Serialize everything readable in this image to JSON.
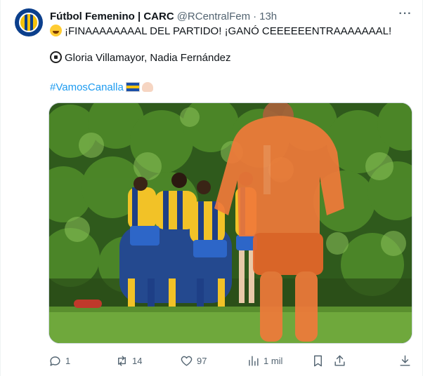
{
  "tweet": {
    "display_name": "Fútbol Femenino | CARC",
    "handle": "@RCentralFem",
    "separator": "·",
    "time": "13h",
    "more_label": "···",
    "line1": "¡FINAAAAAAAAL DEL PARTIDO! ¡GANÓ CEEEEEENTRAAAAAAAL!",
    "line2": "Gloria Villamayor, Nadia Fernández",
    "hashtag": "#VamosCanalla",
    "icons": {
      "line1": "grinning-squinting-face-emoji",
      "line2": "soccer-ball-emoji",
      "hashtag_after": [
        "flag-emoji-blue-yellow",
        "flexed-biceps-emoji"
      ]
    }
  },
  "actions": {
    "reply_count": "1",
    "retweet_count": "14",
    "like_count": "97",
    "views_count": "1 mil"
  },
  "colors": {
    "link": "#1d9bf0",
    "secondary": "#536471",
    "text": "#0f1419",
    "club_blue": "#0b3f8c",
    "club_yellow": "#f4c20d"
  }
}
